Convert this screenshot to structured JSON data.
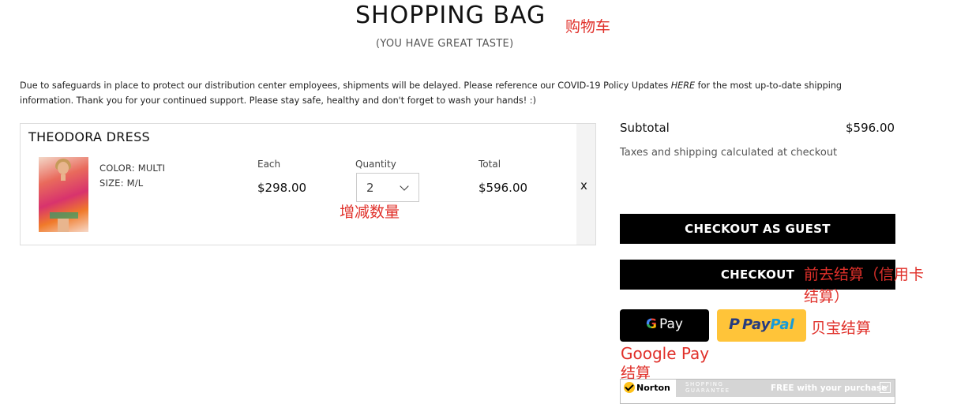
{
  "header": {
    "title": "SHOPPING BAG",
    "subtitle": "(YOU HAVE GREAT TASTE)"
  },
  "notice": {
    "text_before": "Due to safeguards in place to protect our distribution center employees, shipments will be delayed. Please reference our COVID-19 Policy Updates ",
    "link": "HERE",
    "text_after": " for the most up-to-date shipping information. Thank you for your continued support. Please stay safe, healthy and don't forget to wash your hands!  :)"
  },
  "cart": {
    "item": {
      "name": "THEODORA DRESS",
      "color": "COLOR: MULTI",
      "size": "SIZE: M/L",
      "each_label": "Each",
      "each_price": "$298.00",
      "quantity_label": "Quantity",
      "quantity": "2",
      "total_label": "Total",
      "total_price": "$596.00",
      "remove": "x"
    }
  },
  "summary": {
    "subtotal_label": "Subtotal",
    "subtotal_value": "$596.00",
    "tax_note": "Taxes and shipping calculated at checkout",
    "checkout_guest": "CHECKOUT AS GUEST",
    "checkout": "CHECKOUT"
  },
  "wallets": {
    "gpay_g": "G",
    "gpay_pay": "Pay",
    "paypal_p": "P",
    "paypal_pay": "Pay",
    "paypal_pal": "Pal"
  },
  "norton": {
    "brand": "Norton",
    "guarantee_line1": "SHOPPING",
    "guarantee_line2": "GUARANTEE",
    "free_text": "FREE with your purchase"
  },
  "annotations": {
    "bag": "购物车",
    "quantity": "增减数量",
    "checkout_line1": "前去结算（信用卡",
    "checkout_line2": "结算）",
    "paypal": "贝宝结算",
    "gpay_line1": "Google Pay",
    "gpay_line2": "结算"
  },
  "colors": {
    "annotation": "#e0302a",
    "button_black": "#000000",
    "paypal_yellow": "#ffc439",
    "paypal_dark_blue": "#253b80",
    "paypal_light_blue": "#179bd7"
  },
  "icons": [
    "chevron-down-icon",
    "close-icon",
    "google-g-icon",
    "paypal-p-icon",
    "norton-check-icon"
  ]
}
